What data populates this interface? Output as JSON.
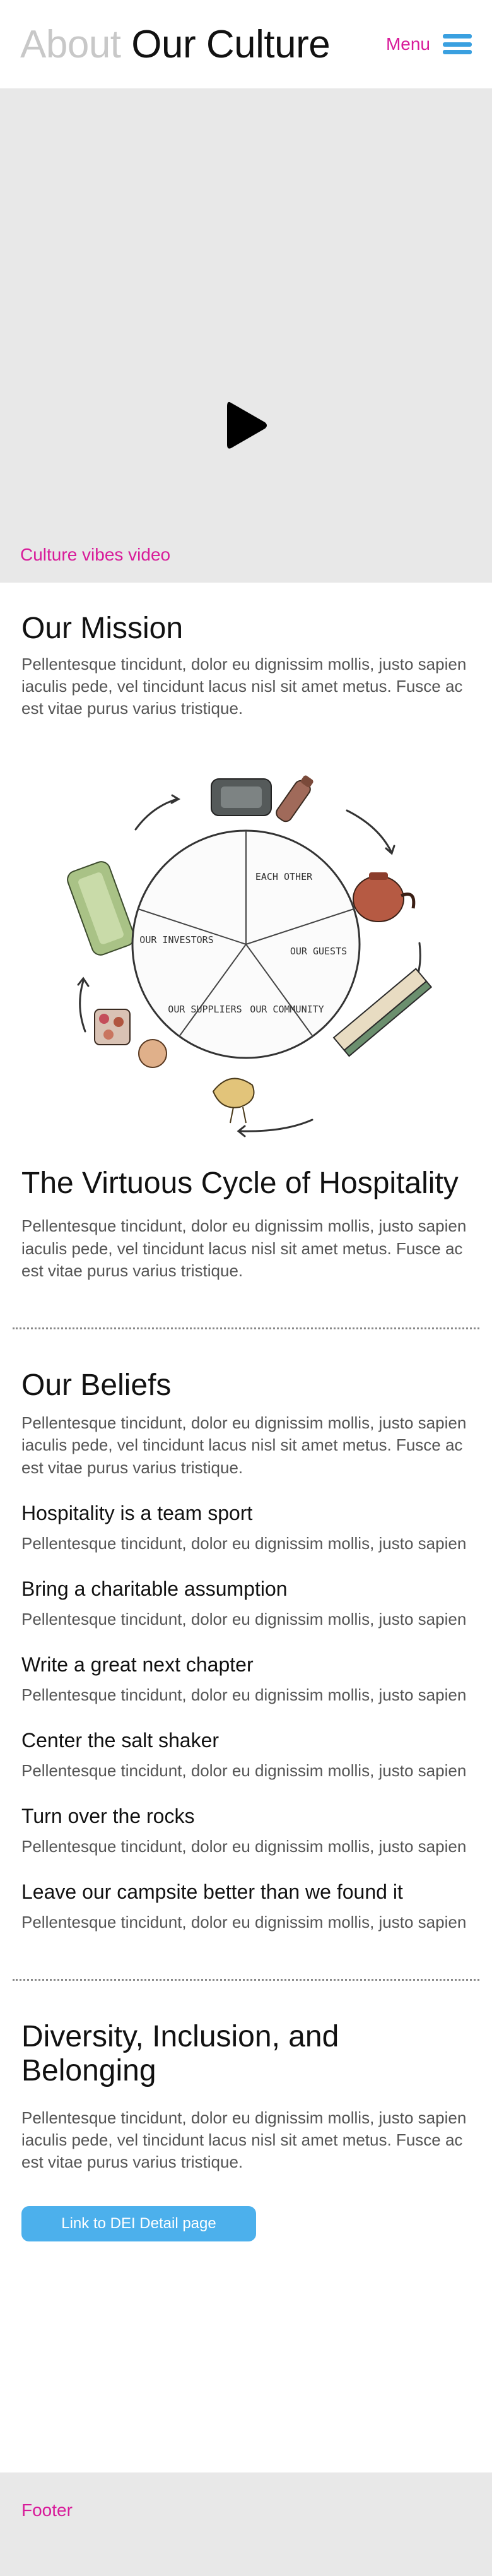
{
  "header": {
    "title_light": "About",
    "title_dark": "Our Culture",
    "menu_label": "Menu"
  },
  "video": {
    "caption": "Culture vibes video"
  },
  "mission": {
    "heading": "Our Mission",
    "body": "Pellentesque tincidunt, dolor eu dignissim mollis, justo sapien iaculis pede, vel tincidunt lacus nisl sit amet metus. Fusce ac est vitae purus varius tristique."
  },
  "cycle_diagram": {
    "segments": [
      "EACH OTHER",
      "OUR GUESTS",
      "OUR COMMUNITY",
      "OUR SUPPLIERS",
      "OUR INVESTORS"
    ]
  },
  "virtuous": {
    "heading": "The Virtuous Cycle of Hospitality",
    "body": "Pellentesque tincidunt, dolor eu dignissim mollis, justo sapien iaculis pede, vel tincidunt lacus nisl sit amet metus. Fusce ac est vitae purus varius tristique."
  },
  "beliefs": {
    "heading": "Our Beliefs",
    "body": "Pellentesque tincidunt, dolor eu dignissim mollis, justo sapien iaculis pede, vel tincidunt lacus nisl sit amet metus. Fusce ac est vitae purus varius tristique.",
    "items": [
      {
        "title": "Hospitality is a team sport",
        "body": "Pellentesque tincidunt, dolor eu dignissim mollis, justo sapien"
      },
      {
        "title": "Bring a charitable assumption",
        "body": "Pellentesque tincidunt, dolor eu dignissim mollis, justo sapien"
      },
      {
        "title": "Write a great next chapter",
        "body": "Pellentesque tincidunt, dolor eu dignissim mollis, justo sapien"
      },
      {
        "title": "Center the salt shaker",
        "body": "Pellentesque tincidunt, dolor eu dignissim mollis, justo sapien"
      },
      {
        "title": "Turn over the rocks",
        "body": "Pellentesque tincidunt, dolor eu dignissim mollis, justo sapien"
      },
      {
        "title": "Leave our campsite better than we found it",
        "body": "Pellentesque tincidunt, dolor eu dignissim mollis, justo sapien"
      }
    ]
  },
  "dei": {
    "heading": "Diversity, Inclusion, and Belonging",
    "body": "Pellentesque tincidunt, dolor eu dignissim mollis, justo sapien iaculis pede, vel tincidunt lacus nisl sit amet metus. Fusce ac est vitae purus varius tristique.",
    "button_label": "Link to DEI Detail page"
  },
  "footer": {
    "label": "Footer"
  },
  "colors": {
    "accent_pink": "#d81b9a",
    "accent_blue": "#3aa0e0",
    "button_blue": "#4cb0ec",
    "panel_gray": "#e8e8e8"
  },
  "icons": {
    "play": "play-icon",
    "menu": "hamburger-menu-icon"
  }
}
